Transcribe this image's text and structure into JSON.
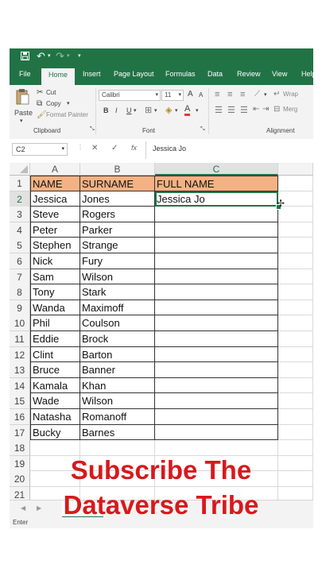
{
  "qat": {
    "save_icon": "save-icon",
    "undo_icon": "undo-icon",
    "redo_icon": "redo-icon",
    "customize_icon": "customize-icon"
  },
  "tabs": [
    "File",
    "Home",
    "Insert",
    "Page Layout",
    "Formulas",
    "Data",
    "Review",
    "View",
    "Help"
  ],
  "active_tab": "Home",
  "ribbon": {
    "clipboard": {
      "paste": "Paste",
      "cut": "Cut",
      "copy": "Copy",
      "format_painter": "Format Painter",
      "label": "Clipboard"
    },
    "font": {
      "name": "Calibri",
      "size": "11",
      "bold": "B",
      "italic": "I",
      "underline": "U",
      "font_color": "A",
      "grow": "A",
      "shrink": "A",
      "label": "Font"
    },
    "alignment": {
      "wrap": "Wrap",
      "merge": "Merg",
      "label": "Alignment"
    }
  },
  "formula_bar": {
    "name_box": "C2",
    "cancel": "✕",
    "enter": "✓",
    "fx": "fx",
    "value": "Jessica Jo"
  },
  "columns": [
    "A",
    "B",
    "C"
  ],
  "rows": [
    {
      "num": "1",
      "a": "NAME",
      "b": "SURNAME",
      "c": "FULL NAME"
    },
    {
      "num": "2",
      "a": "Jessica",
      "b": "Jones",
      "c": "Jessica Jo"
    },
    {
      "num": "3",
      "a": "Steve",
      "b": "Rogers",
      "c": ""
    },
    {
      "num": "4",
      "a": "Peter",
      "b": "Parker",
      "c": ""
    },
    {
      "num": "5",
      "a": "Stephen",
      "b": "Strange",
      "c": ""
    },
    {
      "num": "6",
      "a": "Nick",
      "b": "Fury",
      "c": ""
    },
    {
      "num": "7",
      "a": "Sam",
      "b": "Wilson",
      "c": ""
    },
    {
      "num": "8",
      "a": "Tony",
      "b": "Stark",
      "c": ""
    },
    {
      "num": "9",
      "a": "Wanda",
      "b": "Maximoff",
      "c": ""
    },
    {
      "num": "10",
      "a": "Phil",
      "b": "Coulson",
      "c": ""
    },
    {
      "num": "11",
      "a": "Eddie",
      "b": "Brock",
      "c": ""
    },
    {
      "num": "12",
      "a": "Clint",
      "b": "Barton",
      "c": ""
    },
    {
      "num": "13",
      "a": "Bruce",
      "b": "Banner",
      "c": ""
    },
    {
      "num": "14",
      "a": "Kamala",
      "b": "Khan",
      "c": ""
    },
    {
      "num": "15",
      "a": "Wade",
      "b": "Wilson",
      "c": ""
    },
    {
      "num": "16",
      "a": "Natasha",
      "b": "Romanoff",
      "c": ""
    },
    {
      "num": "17",
      "a": "Bucky",
      "b": "Barnes",
      "c": ""
    },
    {
      "num": "18",
      "a": "",
      "b": "",
      "c": ""
    },
    {
      "num": "19",
      "a": "",
      "b": "",
      "c": ""
    },
    {
      "num": "20",
      "a": "",
      "b": "",
      "c": ""
    },
    {
      "num": "21",
      "a": "",
      "b": "",
      "c": ""
    }
  ],
  "status": {
    "mode": "Enter"
  },
  "overlay": {
    "line1": "Subscribe The",
    "line2": "Dataverse Tribe"
  },
  "colors": {
    "excel_green": "#217346",
    "header_fill": "#f4b183",
    "overlay_red": "#d7191c"
  }
}
